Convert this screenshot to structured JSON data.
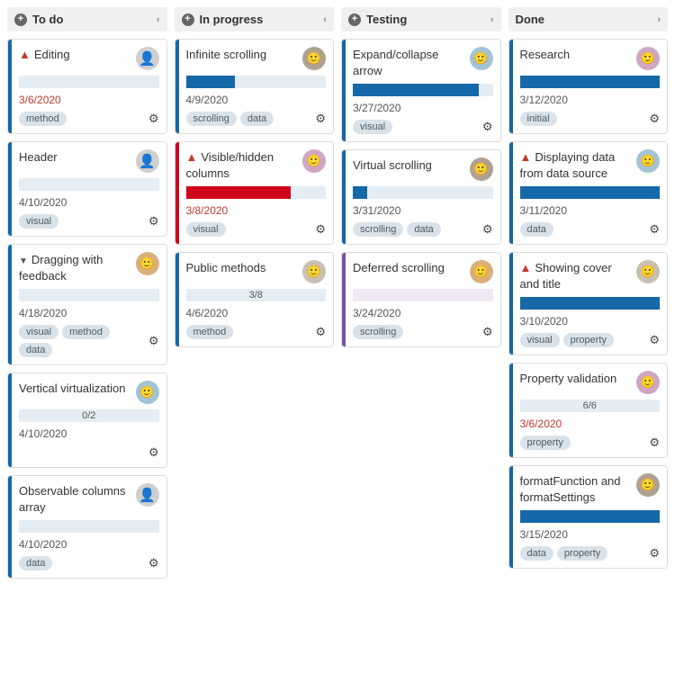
{
  "columns": [
    {
      "id": "todo",
      "title": "To do",
      "addable": true,
      "direction": "left",
      "cards": [
        {
          "title": "Editing",
          "warning": true,
          "accent": "#1768a8",
          "avatar": "gray",
          "progress": 0,
          "progressColor": "blue",
          "date": "3/6/2020",
          "overdue": true,
          "tags": [
            "method"
          ]
        },
        {
          "title": "Header",
          "accent": "#1768a8",
          "avatar": "gray",
          "progress": 0,
          "progressColor": "blue",
          "date": "4/10/2020",
          "tags": [
            "visual"
          ]
        },
        {
          "title": "Dragging with feedback",
          "caret": true,
          "accent": "#1768a8",
          "avatar": "p1",
          "progress": 0,
          "progressColor": "blue",
          "date": "4/18/2020",
          "tags": [
            "visual",
            "method",
            "data"
          ]
        },
        {
          "title": "Vertical virtualization",
          "accent": "#1768a8",
          "avatar": "p2",
          "progressLabel": "0/2",
          "progress": 0,
          "progressColor": "blue",
          "date": "4/10/2020",
          "tags": []
        },
        {
          "title": "Observable columns array",
          "accent": "#1768a8",
          "avatar": "gray",
          "progress": 0,
          "progressColor": "blue",
          "date": "4/10/2020",
          "tags": [
            "data"
          ]
        }
      ]
    },
    {
      "id": "inprogress",
      "title": "In progress",
      "addable": true,
      "direction": "left",
      "cards": [
        {
          "title": "Infinite scrolling",
          "accent": "#1768a8",
          "avatar": "p4",
          "progress": 35,
          "progressColor": "blue",
          "date": "4/9/2020",
          "tags": [
            "scrolling",
            "data"
          ]
        },
        {
          "title": "Visible/hidden columns",
          "warning": true,
          "accent": "#d0021b",
          "avatar": "p3",
          "progress": 75,
          "progressColor": "red",
          "date": "3/8/2020",
          "overdue": true,
          "tags": [
            "visual"
          ]
        },
        {
          "title": "Public methods",
          "accent": "#1768a8",
          "avatar": "p5",
          "progressLabel": "3/8",
          "progress": 0,
          "progressColor": "blue",
          "date": "4/6/2020",
          "tags": [
            "method"
          ]
        }
      ]
    },
    {
      "id": "testing",
      "title": "Testing",
      "addable": true,
      "direction": "left",
      "cards": [
        {
          "title": "Expand/collapse arrow",
          "accent": "#1768a8",
          "avatar": "p2",
          "progress": 90,
          "progressColor": "blue",
          "date": "3/27/2020",
          "tags": [
            "visual"
          ]
        },
        {
          "title": "Virtual scrolling",
          "accent": "#1768a8",
          "avatar": "p4",
          "progress": 10,
          "progressColor": "blue",
          "date": "3/31/2020",
          "tags": [
            "scrolling",
            "data"
          ]
        },
        {
          "title": "Deferred scrolling",
          "accent": "#7b4fa8",
          "avatar": "p1",
          "progress": 0,
          "progressColor": "purple",
          "progressBg": "#f0e8f5",
          "date": "3/24/2020",
          "tags": [
            "scrolling"
          ]
        }
      ]
    },
    {
      "id": "done",
      "title": "Done",
      "addable": false,
      "direction": "right",
      "cards": [
        {
          "title": "Research",
          "accent": "#1768a8",
          "avatar": "p3",
          "progress": 100,
          "progressColor": "blue",
          "date": "3/12/2020",
          "tags": [
            "initial"
          ]
        },
        {
          "title": "Displaying data from data source",
          "warning": true,
          "accent": "#1768a8",
          "avatar": "p2",
          "progress": 100,
          "progressColor": "blue",
          "date": "3/11/2020",
          "tags": [
            "data"
          ]
        },
        {
          "title": "Showing cover and title",
          "warning": true,
          "accent": "#1768a8",
          "avatar": "p5",
          "progress": 100,
          "progressColor": "blue",
          "date": "3/10/2020",
          "tags": [
            "visual",
            "property"
          ]
        },
        {
          "title": "Property validation",
          "accent": "#1768a8",
          "avatar": "p3",
          "progressLabel": "6/6",
          "progress": 0,
          "progressColor": "blue",
          "date": "3/6/2020",
          "overdue": true,
          "tags": [
            "property"
          ]
        },
        {
          "title": "formatFunction and formatSettings",
          "accent": "#1768a8",
          "avatar": "p4",
          "progress": 100,
          "progressColor": "blue",
          "date": "3/15/2020",
          "tags": [
            "data",
            "property"
          ]
        }
      ]
    }
  ]
}
